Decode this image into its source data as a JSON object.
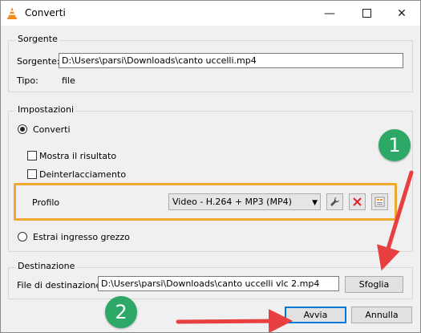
{
  "window": {
    "title": "Converti"
  },
  "source": {
    "group_label": "Sorgente",
    "field_label": "Sorgente:",
    "field_value": "D:\\Users\\parsi\\Downloads\\canto uccelli.mp4",
    "type_label": "Tipo:",
    "type_value": "file"
  },
  "settings": {
    "group_label": "Impostazioni",
    "convert_label": "Converti",
    "show_result_label": "Mostra il risultato",
    "deinterlace_label": "Deinterlacciamento",
    "profile_label": "Profilo",
    "profile_value": "Video - H.264 + MP3 (MP4)",
    "raw_input_label": "Estrai ingresso grezzo"
  },
  "destination": {
    "group_label": "Destinazione",
    "field_label": "File di destinazione:",
    "field_value": "D:\\Users\\parsi\\Downloads\\canto uccelli vlc 2.mp4",
    "browse_label": "Sfoglia"
  },
  "buttons": {
    "start_label": "Avvia",
    "cancel_label": "Annulla"
  },
  "badges": {
    "one": "1",
    "two": "2"
  },
  "colors": {
    "highlight": "#f0a830",
    "arrow": "#e84040",
    "badge": "#2ea867"
  }
}
